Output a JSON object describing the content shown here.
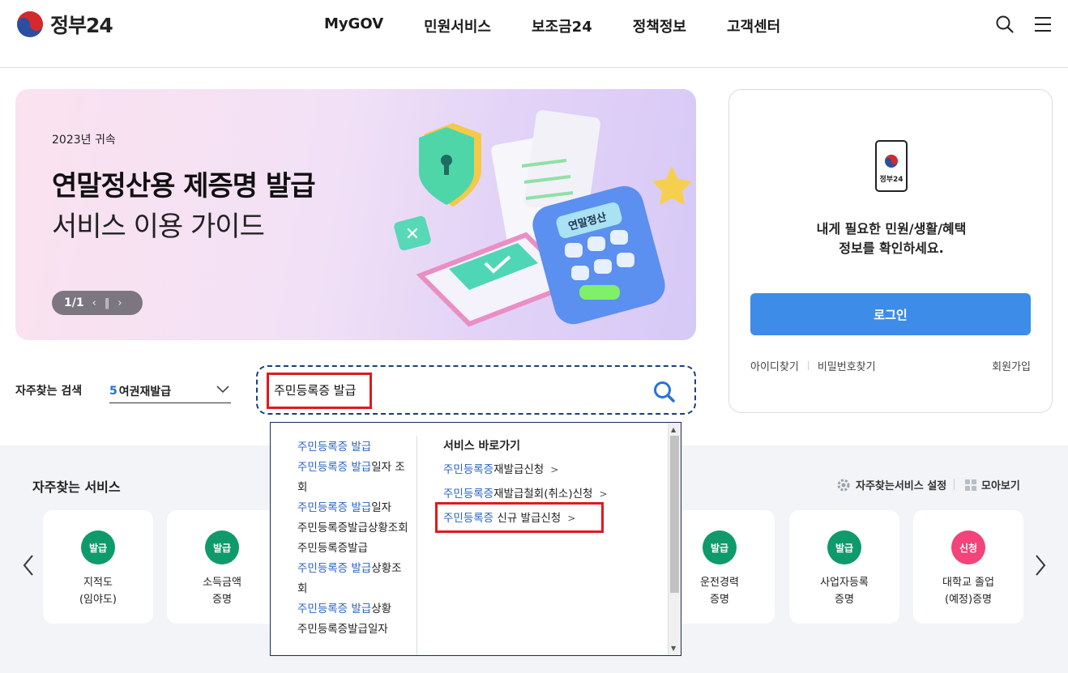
{
  "header": {
    "logo_text": "정부24",
    "nav": [
      "MyGOV",
      "민원서비스",
      "보조금24",
      "정책정보",
      "고객센터"
    ],
    "icons": [
      "search-icon",
      "hamburger-menu-icon"
    ]
  },
  "banner": {
    "year": "2023년 귀속",
    "title_line1": "연말정산용 제증명 발급",
    "title_line2": "서비스 이용 가이드",
    "pager": "1/1",
    "calculator_label": "연말정산"
  },
  "login_panel": {
    "phone_label": "정부24",
    "message_line1": "내게 필요한 민원/생활/혜택",
    "message_line2": "정보를 확인하세요.",
    "login_button": "로그인",
    "find_id": "아이디찾기",
    "find_pw": "비밀번호찾기",
    "join": "회원가입"
  },
  "frequent_search": {
    "label": "자주찾는 검색",
    "selected_rank": "5",
    "selected_value": "여권재발급",
    "search_value": "주민등록증 발급"
  },
  "autocomplete": {
    "suggestions": [
      {
        "hl": "주민등록증 발급",
        "rest": ""
      },
      {
        "hl": "주민등록증 발급",
        "rest": "일자 조회"
      },
      {
        "hl": "주민등록증 발급",
        "rest": "일자"
      },
      {
        "hl": "",
        "rest": "주민등록증발급상황조회"
      },
      {
        "hl": "",
        "rest": "주민등록증발급"
      },
      {
        "hl": "주민등록증 발급",
        "rest": "상황조회"
      },
      {
        "hl": "주민등록증 발급",
        "rest": "상황"
      },
      {
        "hl": "",
        "rest": "주민등록증발급일자"
      }
    ],
    "services_title": "서비스 바로가기",
    "services": [
      {
        "hl": "주민등록증",
        "rest": "재발급신청"
      },
      {
        "hl": "주민등록증",
        "rest": "재발급철회(취소)신청"
      },
      {
        "hl": "주민등록증",
        "rest": " 신규 발급신청"
      }
    ]
  },
  "frequent_services": {
    "title": "자주찾는 서비스",
    "settings_label": "자주찾는서비스 설정",
    "view_all_label": "모아보기",
    "cards": [
      {
        "badge": "발급",
        "name": "지적도\n(임야도)",
        "color": "#0f9a6b"
      },
      {
        "badge": "발급",
        "name": "소득금액\n증명",
        "color": "#0f9a6b"
      },
      {
        "badge": "발급",
        "name": "운전경력\n증명",
        "color": "#0f9a6b"
      },
      {
        "badge": "발급",
        "name": "사업자등록\n증명",
        "color": "#0f9a6b"
      },
      {
        "badge": "신청",
        "name": "대학교 졸업\n(예정)증명",
        "color": "#f2437a"
      }
    ]
  },
  "colors": {
    "primary_blue": "#3c8ce8",
    "highlight_text": "#2a63c4",
    "annotation_red": "#e0191d"
  }
}
